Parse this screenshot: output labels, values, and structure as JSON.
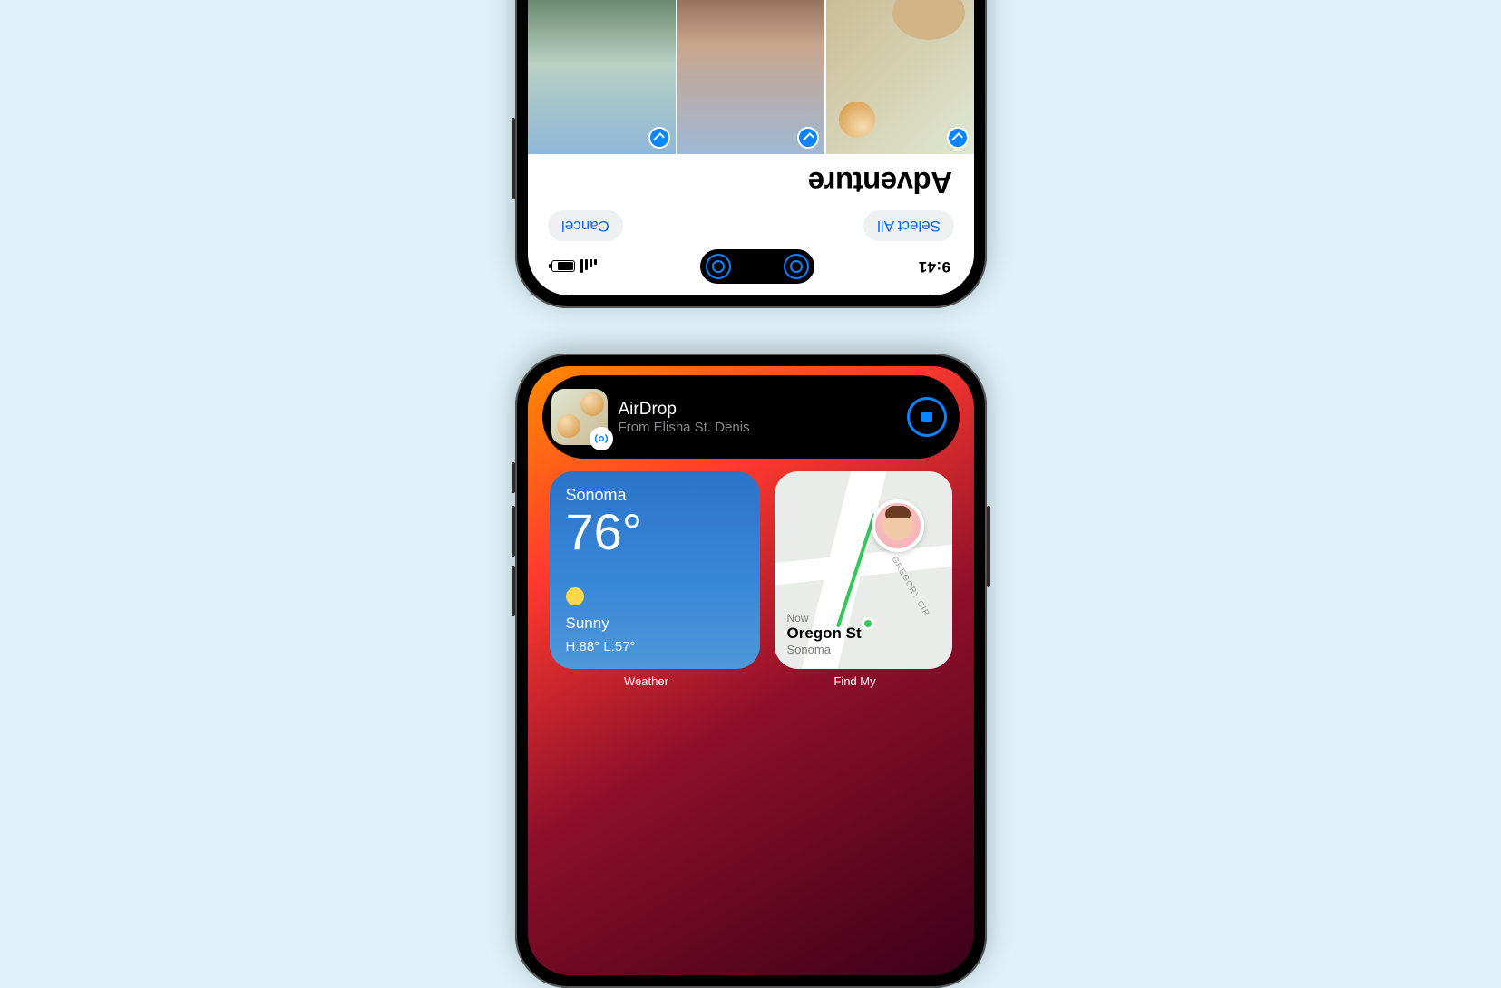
{
  "topPhone": {
    "time": "9:41",
    "select_all_label": "Select All",
    "cancel_label": "Cancel",
    "album_title": "Adventure"
  },
  "bottomPhone": {
    "dynamic_island": {
      "title": "AirDrop",
      "subtitle": "From Elisha St. Denis"
    },
    "weather": {
      "location": "Sonoma",
      "temperature": "76°",
      "condition": "Sunny",
      "high_low": "H:88° L:57°",
      "app_label": "Weather"
    },
    "findmy": {
      "now_label": "Now",
      "street": "Oregon St",
      "city": "Sonoma",
      "road_label": "GREGORY CIR",
      "app_label": "Find My"
    }
  }
}
